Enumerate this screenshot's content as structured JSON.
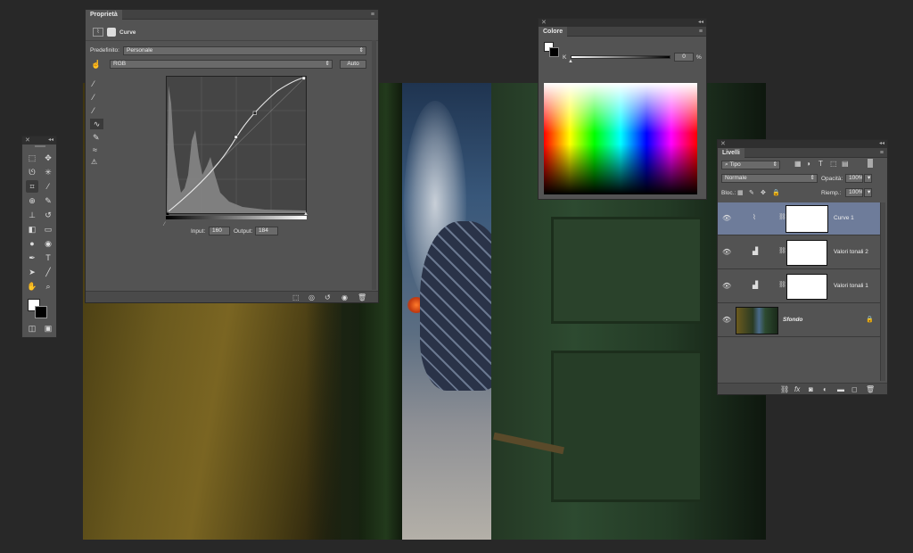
{
  "properties": {
    "tab": "Proprietà",
    "type_label": "Curve",
    "preset_label": "Predefinito:",
    "preset_value": "Personale",
    "channel_value": "RGB",
    "auto_label": "Auto",
    "input_label": "Input:",
    "input_value": "160",
    "output_label": "Output:",
    "output_value": "184"
  },
  "colore": {
    "tab": "Colore",
    "k_label": "K",
    "k_value": "0",
    "k_unit": "%"
  },
  "livelli": {
    "tab": "Livelli",
    "filter_value": "Tipo",
    "blend_mode": "Normale",
    "opacity_label": "Opacità:",
    "opacity_value": "100%",
    "lock_label": "Bloc.:",
    "fill_label": "Riemp.:",
    "fill_value": "100%",
    "layers": [
      {
        "name": "Curve 1",
        "selected": true
      },
      {
        "name": "Valori tonali 2",
        "selected": false
      },
      {
        "name": "Valori tonali 1",
        "selected": false
      },
      {
        "name": "Sfondo",
        "selected": false
      }
    ]
  },
  "icons": {
    "eye": "eye-icon",
    "link": "chain-link-icon",
    "lock": "lock-icon",
    "curves": "curves-adjustment-icon",
    "levels": "levels-adjustment-icon"
  },
  "colors": {
    "panel": "#535353",
    "selected_layer": "#6e7c9a"
  }
}
